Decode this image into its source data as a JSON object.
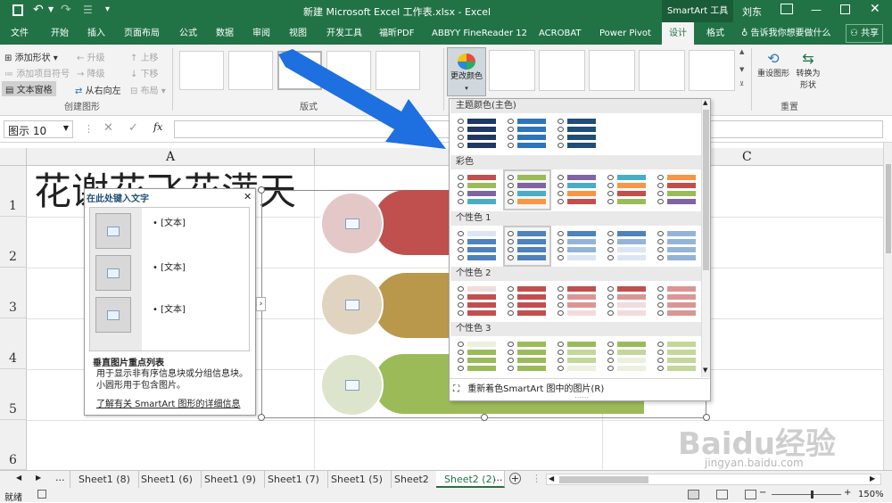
{
  "titlebar": {
    "doc_title": "新建 Microsoft Excel 工作表.xlsx  -  Excel",
    "context_tab": "SmartArt 工具",
    "user": "刘东"
  },
  "tabs": [
    "文件",
    "开始",
    "插入",
    "页面布局",
    "公式",
    "数据",
    "审阅",
    "视图",
    "开发工具",
    "福昕PDF",
    "ABBYY FineReader 12",
    "ACROBAT",
    "Power Pivot",
    "设计",
    "格式"
  ],
  "tell_me": "告诉我你想要做什么",
  "share": "共享",
  "ribbon": {
    "add_shape": "添加形状",
    "add_bullet": "添加项目符号",
    "text_pane": "文本窗格",
    "promote": "升级",
    "demote": "降级",
    "right_to_left": "从右向左",
    "move_up": "上移",
    "move_down": "下移",
    "layout": "布局",
    "group_create": "创建图形",
    "group_layouts": "版式",
    "change_colors": "更改颜色",
    "reset_graphic": "重设图形",
    "convert_shape": "转换为形状",
    "group_reset": "重置"
  },
  "formula_bar": {
    "name_box": "图示 10",
    "fx": "fx"
  },
  "columns": [
    "A",
    "B",
    "C"
  ],
  "rows": [
    "1",
    "2",
    "3",
    "4",
    "5",
    "6"
  ],
  "cell_title": "花谢花飞花满天",
  "text_pane": {
    "title": "在此处键入文字",
    "items": [
      "[文本]",
      "[文本]",
      "[文本]"
    ],
    "desc_title": "垂直图片重点列表",
    "desc": "用于显示非有序信息块或分组信息块。小圆形用于包含图片。",
    "link": "了解有关 SmartArt 图形的详细信息"
  },
  "palette": {
    "sections": [
      "主题颜色(主色)",
      "彩色",
      "个性色 1",
      "个性色 2",
      "个性色 3"
    ],
    "footer": "重新着色SmartArt 图中的图片(R)",
    "colors": {
      "primary": [
        "#1f3864",
        "#2e75b6",
        "#1f4e79"
      ],
      "colorful": [
        "#c0504d",
        "#9bbb59",
        "#8064a2",
        "#4bacc6",
        "#f79646"
      ],
      "accent1": [
        "#4f81bd",
        "#95b3d7",
        "#dce6f2"
      ],
      "accent2": [
        "#c0504d",
        "#da9694",
        "#f2dcdb"
      ],
      "accent3": [
        "#9bbb59",
        "#c4d79b",
        "#ebf1de"
      ]
    }
  },
  "smartart_colors": [
    "#c0504d",
    "#b9984b",
    "#9bbb59"
  ],
  "sheets": [
    "Sheet1 (8)",
    "Sheet1 (6)",
    "Sheet1 (9)",
    "Sheet1 (7)",
    "Sheet1 (5)",
    "Sheet2",
    "Sheet2 (2)"
  ],
  "status": {
    "ready": "就绪",
    "zoom": "150%"
  },
  "watermark": "Baidu经验",
  "watermark_url": "jingyan.baidu.com"
}
